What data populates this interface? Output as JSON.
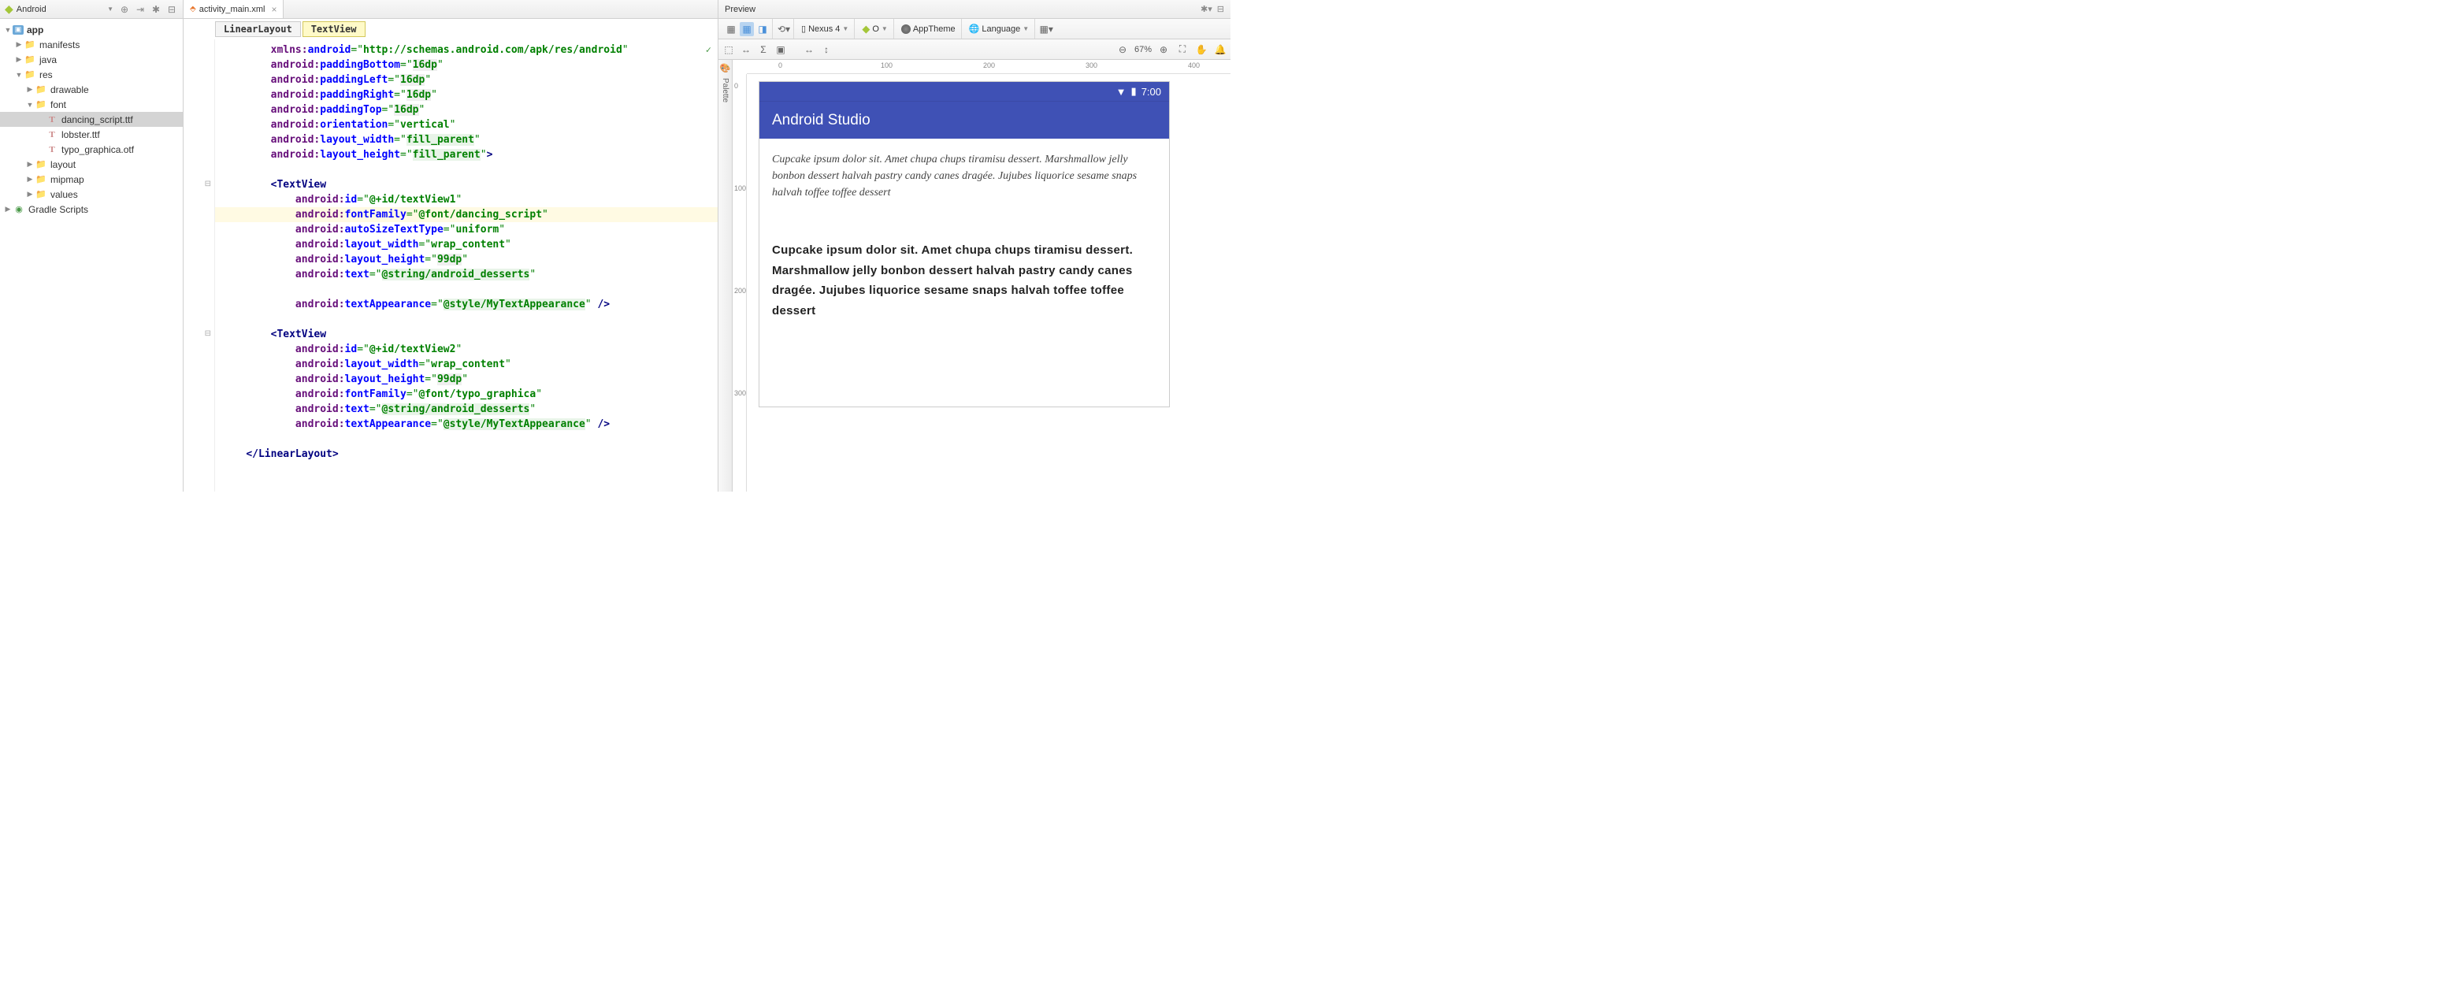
{
  "project": {
    "view_label": "Android",
    "tree": {
      "app": "app",
      "manifests": "manifests",
      "java": "java",
      "res": "res",
      "drawable": "drawable",
      "font": "font",
      "dancing_script": "dancing_script.ttf",
      "lobster": "lobster.ttf",
      "typo_graphica": "typo_graphica.otf",
      "layout": "layout",
      "mipmap": "mipmap",
      "values": "values",
      "gradle_scripts": "Gradle Scripts"
    }
  },
  "editor": {
    "tab_filename": "activity_main.xml",
    "breadcrumb1": "LinearLayout",
    "breadcrumb2": "TextView",
    "code": {
      "l1_ns": "xmlns:",
      "l1_attr": "android",
      "l1_val": "http://schemas.android.com/apk/res/android",
      "l2_ns": "android:",
      "l2_attr": "paddingBottom",
      "l2_val": "16dp",
      "l3_ns": "android:",
      "l3_attr": "paddingLeft",
      "l3_val": "16dp",
      "l4_ns": "android:",
      "l4_attr": "paddingRight",
      "l4_val": "16dp",
      "l5_ns": "android:",
      "l5_attr": "paddingTop",
      "l5_val": "16dp",
      "l6_ns": "android:",
      "l6_attr": "orientation",
      "l6_val": "vertical",
      "l7_ns": "android:",
      "l7_attr": "layout_width",
      "l7_val": "fill_parent",
      "l8_ns": "android:",
      "l8_attr": "layout_height",
      "l8_val": "fill_parent",
      "tv_tag": "TextView",
      "tv1_id_attr": "id",
      "tv1_id_val": "@+id/textView1",
      "tv1_ff_attr": "fontFamily",
      "tv1_ff_val": "@font/dancing_script",
      "tv1_as_attr": "autoSizeTextType",
      "tv1_as_val": "uniform",
      "tv1_lw_attr": "layout_width",
      "tv1_lw_val": "wrap_content",
      "tv1_lh_attr": "layout_height",
      "tv1_lh_val": "99dp",
      "tv1_tx_attr": "text",
      "tv1_tx_val": "@string/android_desserts",
      "tv1_ta_attr": "textAppearance",
      "tv1_ta_val": "@style/MyTextAppearance",
      "tv2_id_attr": "id",
      "tv2_id_val": "@+id/textView2",
      "tv2_lw_attr": "layout_width",
      "tv2_lw_val": "wrap_content",
      "tv2_lh_attr": "layout_height",
      "tv2_lh_val": "99dp",
      "tv2_ff_attr": "fontFamily",
      "tv2_ff_val": "@font/typo_graphica",
      "tv2_tx_attr": "text",
      "tv2_tx_val": "@string/android_desserts",
      "tv2_ta_attr": "textAppearance",
      "tv2_ta_val": "@style/MyTextAppearance",
      "close_tag": "LinearLayout"
    }
  },
  "preview": {
    "title": "Preview",
    "palette": "Palette",
    "device": "Nexus 4",
    "theme": "AppTheme",
    "language": "Language",
    "zoom": "67%",
    "ruler_h": {
      "r0": "0",
      "r100": "100",
      "r200": "200",
      "r300": "300",
      "r400": "400"
    },
    "ruler_v": {
      "r0": "0",
      "r100": "100",
      "r200": "200",
      "r300": "300"
    },
    "status_time": "7:00",
    "app_title": "Android Studio",
    "text1": "Cupcake ipsum dolor sit. Amet chupa chups tiramisu dessert. Marshmallow jelly bonbon dessert halvah pastry candy canes dragée. Jujubes liquorice sesame snaps halvah toffee toffee dessert",
    "text2": "Cupcake ipsum dolor sit. Amet chupa chups tiramisu dessert. Marshmallow jelly bonbon dessert halvah pastry candy canes dragée. Jujubes liquorice sesame snaps halvah toffee toffee dessert"
  }
}
